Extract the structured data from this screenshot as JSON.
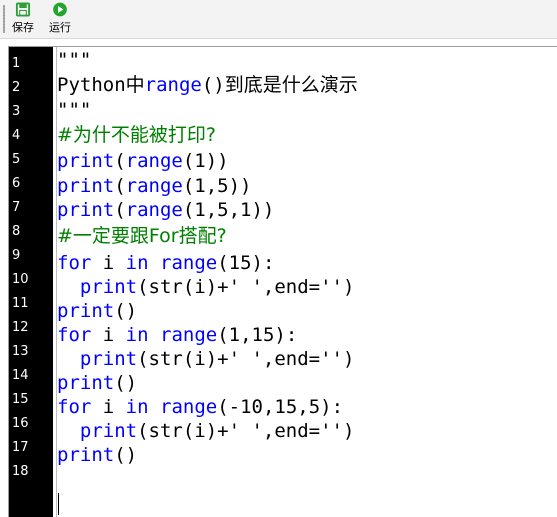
{
  "toolbar": {
    "save_label": "保存",
    "run_label": "运行",
    "save_icon": "floppy-disk-icon",
    "run_icon": "play-icon",
    "save_icon_color": "#2e9d3a",
    "run_icon_color": "#22a52e"
  },
  "editor": {
    "line_numbers": [
      "1",
      "2",
      "3",
      "4",
      "5",
      "6",
      "7",
      "8",
      "9",
      "10",
      "11",
      "12",
      "13",
      "14",
      "15",
      "16",
      "17",
      "18"
    ],
    "keyword_color": "#0000ff",
    "comment_color": "#008000",
    "gutter_color": "#000000",
    "lines": [
      [
        {
          "t": "\"\"\""
        }
      ],
      [
        {
          "t": "Python"
        },
        {
          "t": "中",
          "c": "cjk"
        },
        {
          "t": "range",
          "c": "kw"
        },
        {
          "t": "()"
        },
        {
          "t": "到底是什么演示",
          "c": "cjk"
        }
      ],
      [
        {
          "t": "\"\"\""
        }
      ],
      [
        {
          "t": "#为什不能被打印?",
          "c": "cm cjk"
        }
      ],
      [
        {
          "t": "print",
          "c": "kw"
        },
        {
          "t": "("
        },
        {
          "t": "range",
          "c": "kw"
        },
        {
          "t": "(1))"
        }
      ],
      [
        {
          "t": "print",
          "c": "kw"
        },
        {
          "t": "("
        },
        {
          "t": "range",
          "c": "kw"
        },
        {
          "t": "(1,5))"
        }
      ],
      [
        {
          "t": "print",
          "c": "kw"
        },
        {
          "t": "("
        },
        {
          "t": "range",
          "c": "kw"
        },
        {
          "t": "(1,5,1))"
        }
      ],
      [
        {
          "t": "#一定要跟For搭配?",
          "c": "cm cjk"
        }
      ],
      [
        {
          "t": "for",
          "c": "kw"
        },
        {
          "t": " i "
        },
        {
          "t": "in",
          "c": "kw"
        },
        {
          "t": " "
        },
        {
          "t": "range",
          "c": "kw"
        },
        {
          "t": "(15):"
        }
      ],
      [
        {
          "t": "  "
        },
        {
          "t": "print",
          "c": "kw"
        },
        {
          "t": "(str(i)+' ',end='')"
        }
      ],
      [
        {
          "t": "print",
          "c": "kw"
        },
        {
          "t": "()"
        }
      ],
      [
        {
          "t": "for",
          "c": "kw"
        },
        {
          "t": " i "
        },
        {
          "t": "in",
          "c": "kw"
        },
        {
          "t": " "
        },
        {
          "t": "range",
          "c": "kw"
        },
        {
          "t": "(1,15):"
        }
      ],
      [
        {
          "t": "  "
        },
        {
          "t": "print",
          "c": "kw"
        },
        {
          "t": "(str(i)+' ',end='')"
        }
      ],
      [
        {
          "t": "print",
          "c": "kw"
        },
        {
          "t": "()"
        }
      ],
      [
        {
          "t": "for",
          "c": "kw"
        },
        {
          "t": " i "
        },
        {
          "t": "in",
          "c": "kw"
        },
        {
          "t": " "
        },
        {
          "t": "range",
          "c": "kw"
        },
        {
          "t": "(-10,15,5):"
        }
      ],
      [
        {
          "t": "  "
        },
        {
          "t": "print",
          "c": "kw"
        },
        {
          "t": "(str(i)+' ',end='')"
        }
      ],
      [
        {
          "t": "print",
          "c": "kw"
        },
        {
          "t": "()"
        }
      ],
      [
        {
          "t": ""
        }
      ]
    ]
  }
}
